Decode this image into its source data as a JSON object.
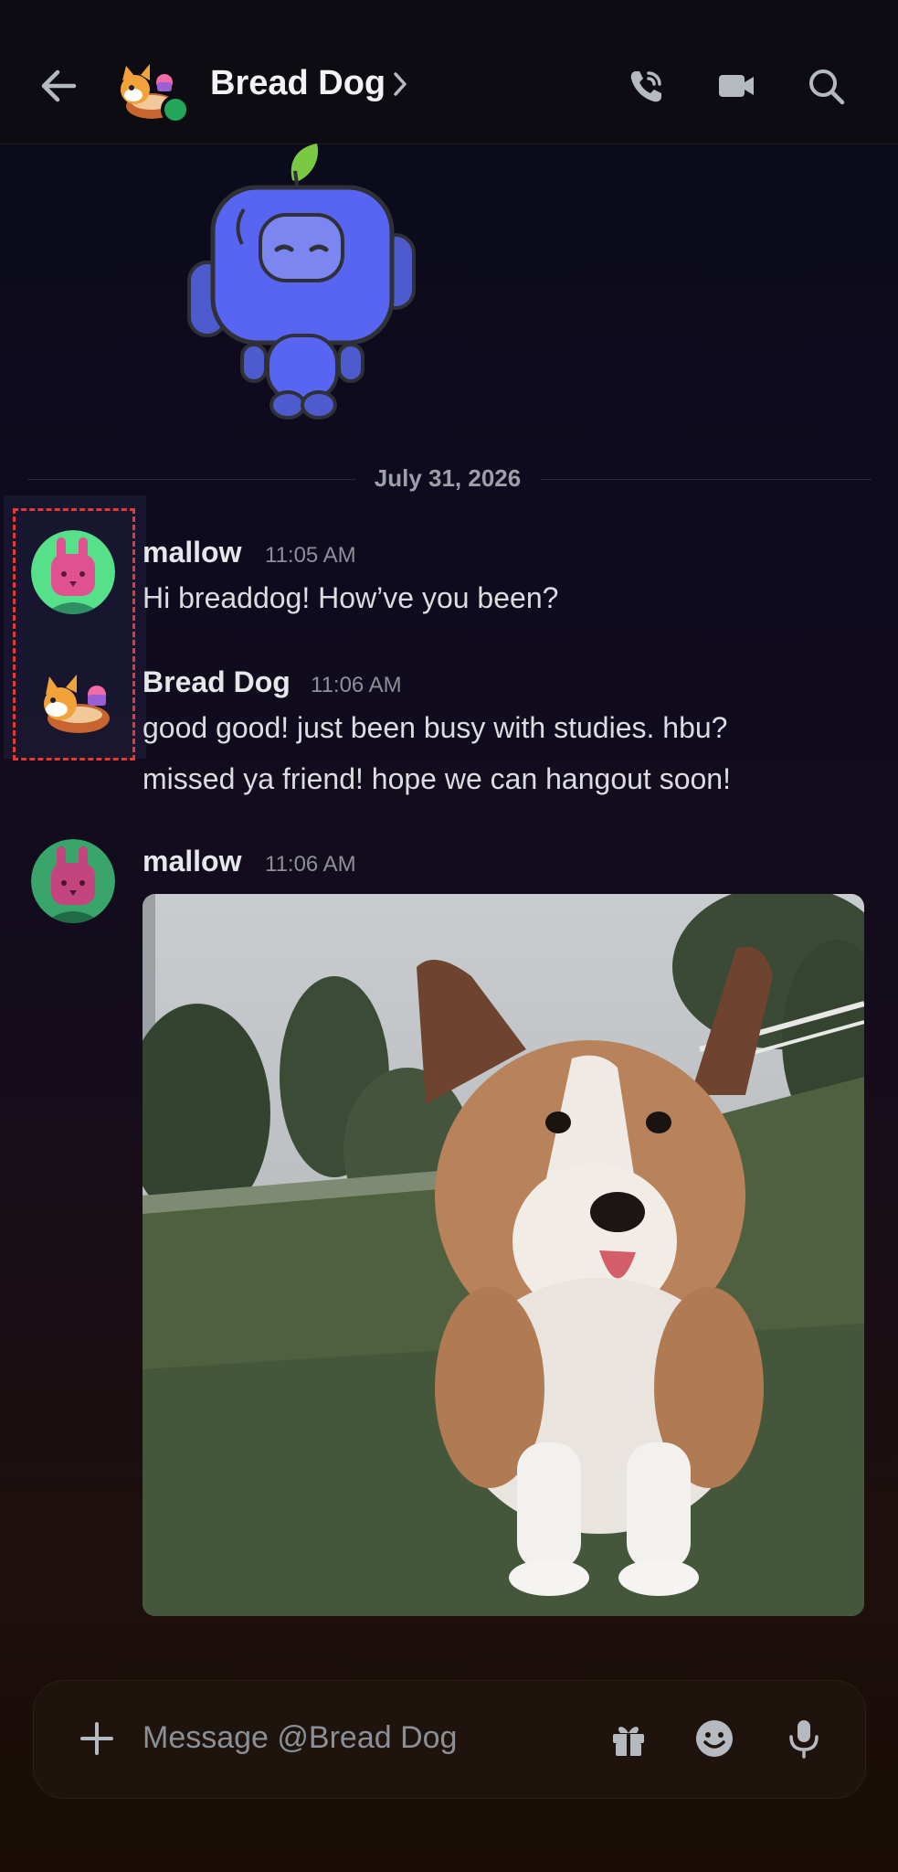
{
  "header": {
    "title": "Bread Dog",
    "back_icon": "arrow-left-icon",
    "call_icon": "phone-call-icon",
    "video_icon": "video-camera-icon",
    "search_icon": "search-icon"
  },
  "chat": {
    "date_divider": "July 31, 2026",
    "messages": [
      {
        "author": "mallow",
        "time": "11:05 AM",
        "lines": [
          "Hi breaddog! How’ve you been?"
        ]
      },
      {
        "author": "Bread Dog",
        "time": "11:06 AM",
        "lines": [
          "good good! just been busy with studies. hbu?",
          "missed ya friend! hope we can hangout soon!"
        ]
      },
      {
        "author": "mallow",
        "time": "11:06 AM",
        "attachment": "corgi-photo"
      }
    ]
  },
  "composer": {
    "placeholder": "Message @Bread Dog",
    "add_icon": "plus-icon",
    "gift_icon": "gift-icon",
    "emoji_icon": "emoji-icon",
    "mic_icon": "microphone-icon"
  },
  "colors": {
    "online": "#23a55a",
    "selection": "#e53935",
    "wumpus": "#5865f2",
    "mallow_bg": "#57e08a",
    "mallow_face": "#e0528f"
  }
}
